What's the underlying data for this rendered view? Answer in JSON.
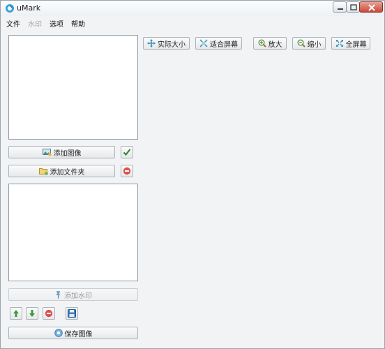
{
  "window": {
    "title": "uMark"
  },
  "menu": [
    {
      "label": "文件",
      "enabled": true
    },
    {
      "label": "水印",
      "enabled": false
    },
    {
      "label": "选项",
      "enabled": true
    },
    {
      "label": "帮助",
      "enabled": true
    }
  ],
  "toolbar": {
    "actual_size": "实际大小",
    "fit_screen": "适合屏幕",
    "zoom_in": "放大",
    "zoom_out": "缩小",
    "fullscreen": "全屏幕"
  },
  "left": {
    "add_image": "添加图像",
    "add_folder": "添加文件夹",
    "add_watermark": "添加水印",
    "save_image": "保存图像"
  },
  "colors": {
    "accent_green": "#2e8b2e",
    "remove_red": "#d9534f",
    "title_bg": "#eef1f4"
  },
  "icons": [
    "app-logo-icon",
    "minimize-icon",
    "maximize-icon",
    "close-icon",
    "arrows-out-icon",
    "fit-screen-icon",
    "zoom-in-icon",
    "zoom-out-icon",
    "fullscreen-icon",
    "add-image-icon",
    "add-folder-icon",
    "checkmark-icon",
    "remove-icon",
    "watermark-pin-icon",
    "move-up-icon",
    "move-down-icon",
    "delete-icon",
    "save-disk-icon",
    "save-image-icon"
  ]
}
